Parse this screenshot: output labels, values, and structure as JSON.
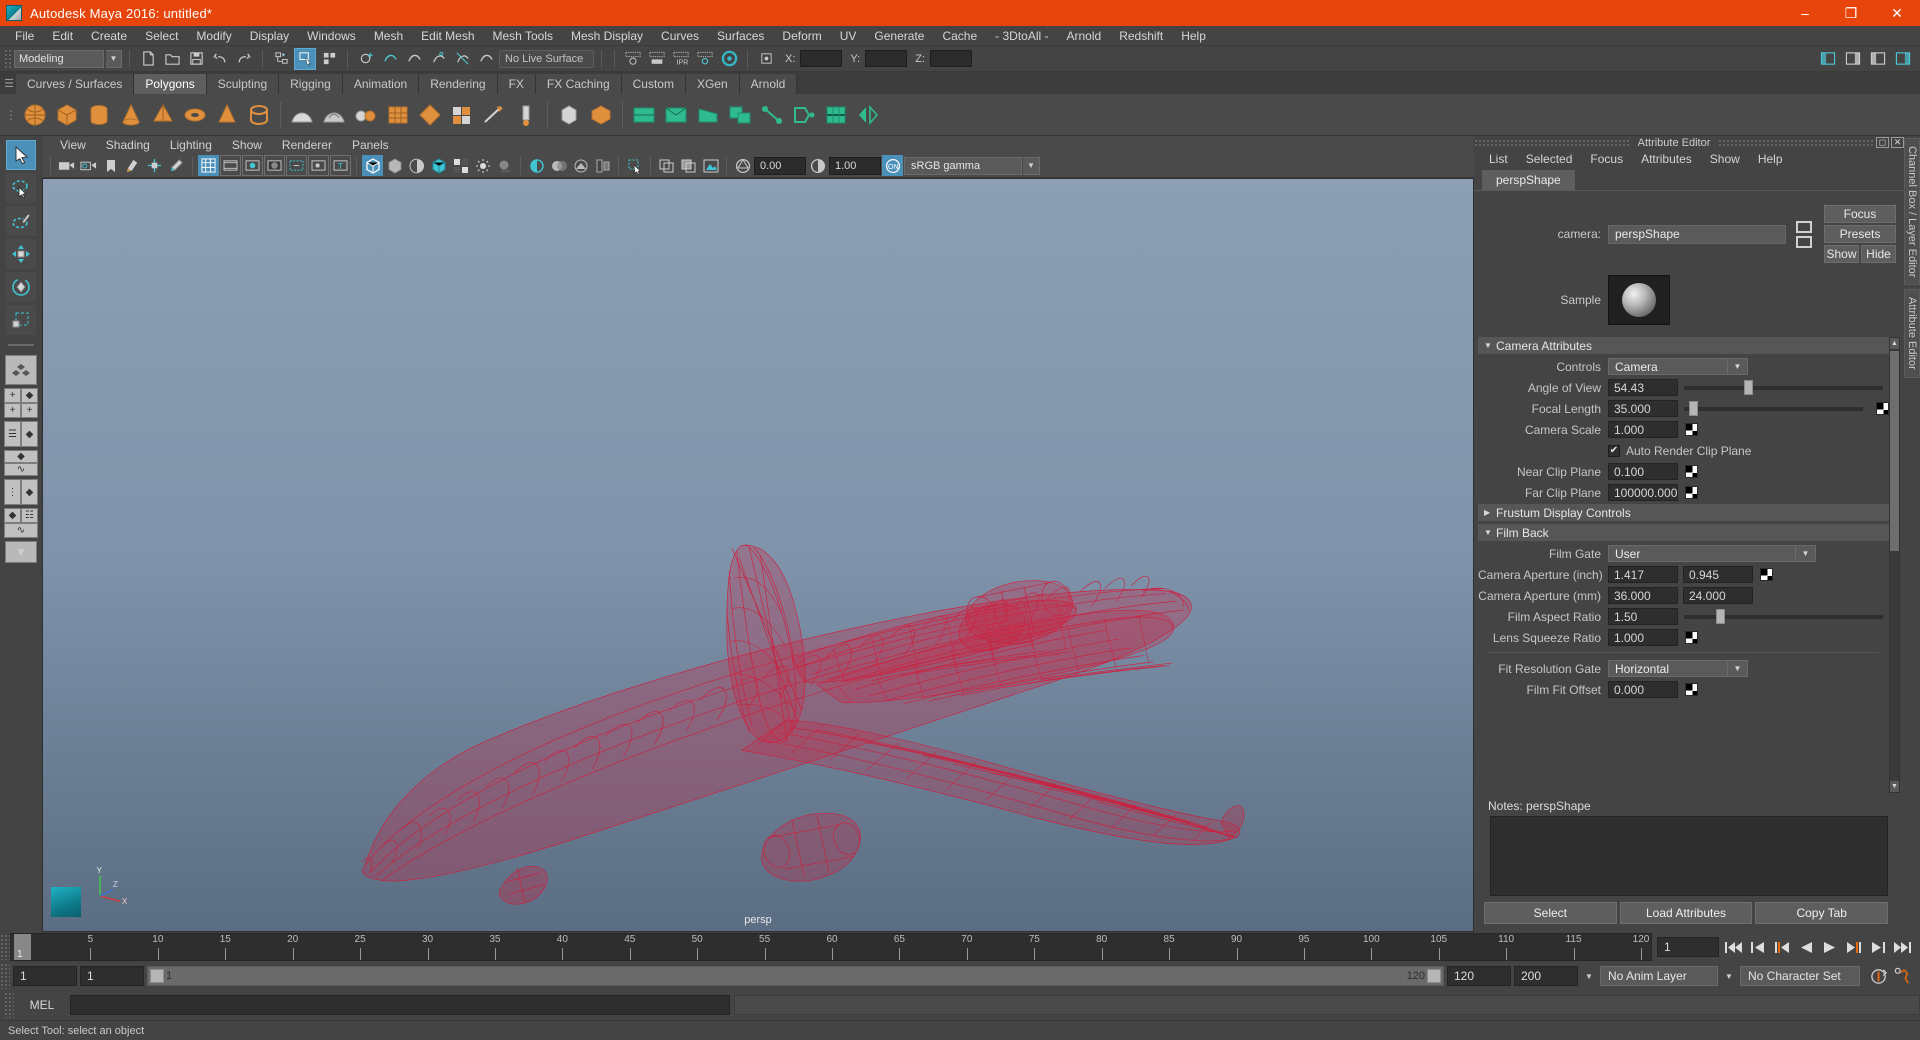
{
  "window": {
    "title": "Autodesk Maya 2016: untitled*",
    "minimize": "–",
    "maximize": "❐",
    "close": "✕"
  },
  "menubar": [
    "File",
    "Edit",
    "Create",
    "Select",
    "Modify",
    "Display",
    "Windows",
    "Mesh",
    "Edit Mesh",
    "Mesh Tools",
    "Mesh Display",
    "Curves",
    "Surfaces",
    "Deform",
    "UV",
    "Generate",
    "Cache",
    "- 3DtoAll -",
    "Arnold",
    "Redshift",
    "Help"
  ],
  "statusline": {
    "menuset": "Modeling",
    "live_surface": "No Live Surface",
    "coord_labels": [
      "X:",
      "Y:",
      "Z:"
    ],
    "coord_values": [
      "",
      "",
      ""
    ]
  },
  "shelf": {
    "tabs": [
      "Curves / Surfaces",
      "Polygons",
      "Sculpting",
      "Rigging",
      "Animation",
      "Rendering",
      "FX",
      "FX Caching",
      "Custom",
      "XGen",
      "Arnold"
    ],
    "active_tab": "Polygons"
  },
  "viewport": {
    "menus": [
      "View",
      "Shading",
      "Lighting",
      "Show",
      "Renderer",
      "Panels"
    ],
    "exposure_value": "0.00",
    "gamma_value": "1.00",
    "color_profile": "sRGB gamma",
    "camera_label": "persp",
    "axis_labels": {
      "y": "Y",
      "x": "X",
      "z": "Z"
    }
  },
  "attribute_editor": {
    "panel_title": "Attribute Editor",
    "menus": [
      "List",
      "Selected",
      "Focus",
      "Attributes",
      "Show",
      "Help"
    ],
    "tab": "perspShape",
    "camera_label": "camera:",
    "camera_value": "perspShape",
    "buttons": {
      "focus": "Focus",
      "presets": "Presets",
      "show": "Show",
      "hide": "Hide"
    },
    "sample_label": "Sample",
    "sections": {
      "camera_attributes": {
        "title": "Camera Attributes",
        "expanded": true,
        "rows": [
          {
            "label": "Controls",
            "type": "dropdown",
            "value": "Camera"
          },
          {
            "label": "Angle of View",
            "type": "slider",
            "value": "54.43",
            "pos": 30
          },
          {
            "label": "Focal Length",
            "type": "slider",
            "value": "35.000",
            "pos": 3
          },
          {
            "label": "Camera Scale",
            "type": "field",
            "value": "1.000"
          },
          {
            "label": "Auto Render Clip Plane",
            "type": "checkbox",
            "checked": true
          },
          {
            "label": "Near Clip Plane",
            "type": "field",
            "value": "0.100"
          },
          {
            "label": "Far Clip Plane",
            "type": "field",
            "value": "100000.000"
          }
        ]
      },
      "frustum": {
        "title": "Frustum Display Controls",
        "expanded": false
      },
      "film_back": {
        "title": "Film Back",
        "expanded": true,
        "rows": [
          {
            "label": "Film Gate",
            "type": "dropdown-wide",
            "value": "User"
          },
          {
            "label": "Camera Aperture (inch)",
            "type": "field2",
            "value": "1.417",
            "value2": "0.945"
          },
          {
            "label": "Camera Aperture (mm)",
            "type": "field2",
            "value": "36.000",
            "value2": "24.000"
          },
          {
            "label": "Film Aspect Ratio",
            "type": "slider",
            "value": "1.50",
            "pos": 16
          },
          {
            "label": "Lens Squeeze Ratio",
            "type": "field",
            "value": "1.000"
          },
          {
            "label": "Fit Resolution Gate",
            "type": "dropdown",
            "value": "Horizontal"
          },
          {
            "label": "Film Fit Offset",
            "type": "field",
            "value": "0.000"
          }
        ]
      }
    },
    "notes_label": "Notes:  perspShape",
    "notes_value": "",
    "footer_buttons": [
      "Select",
      "Load Attributes",
      "Copy Tab"
    ]
  },
  "vertical_tabs": [
    "Channel Box / Layer Editor",
    "Attribute Editor"
  ],
  "timeline": {
    "ticks": [
      5,
      10,
      15,
      20,
      25,
      30,
      35,
      40,
      45,
      50,
      55,
      60,
      65,
      70,
      75,
      80,
      85,
      90,
      95,
      100,
      105,
      110,
      115,
      120
    ],
    "current_frame": "1",
    "current_frame_field": "1",
    "range_start": "1",
    "range_end": "1",
    "playback_end": "120",
    "anim_end": "120",
    "total_end": "200",
    "anim_layer": "No Anim Layer",
    "character_set": "No Character Set"
  },
  "command_line": {
    "label": "MEL",
    "input_value": "",
    "output_value": ""
  },
  "status_bar": {
    "message": "Select Tool: select an object"
  },
  "colors": {
    "title_bar": "#e8450c",
    "accent_blue": "#4a90b8",
    "shelf_icon": "#e0903c",
    "model_red": "#cf1f3d",
    "panel_bg": "#444444"
  }
}
